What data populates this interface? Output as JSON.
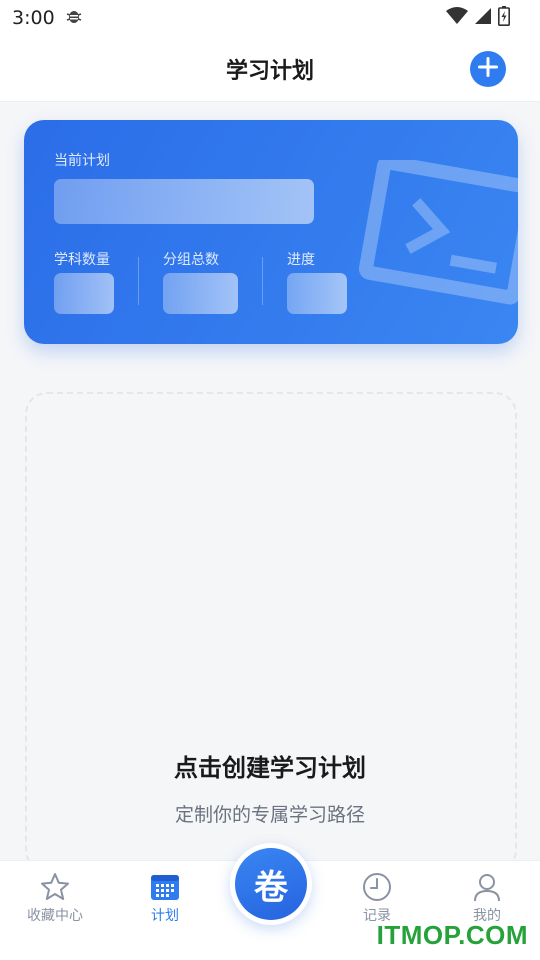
{
  "status_bar": {
    "time": "3:00"
  },
  "header": {
    "title": "学习计划",
    "add_icon": "plus-icon"
  },
  "plan_card": {
    "current_plan_label": "当前计划",
    "subject_count_label": "学科数量",
    "group_total_label": "分组总数",
    "progress_label": "进度",
    "decoration_icon": "terminal-icon"
  },
  "empty_state": {
    "title": "点击创建学习计划",
    "subtitle": "定制你的专属学习路径"
  },
  "tab_bar": {
    "tabs": [
      {
        "label": "收藏中心",
        "icon": "star-icon"
      },
      {
        "label": "计划",
        "icon": "calendar-icon"
      },
      {
        "label": "记录",
        "icon": "clock-icon"
      },
      {
        "label": "我的",
        "icon": "user-icon"
      }
    ],
    "center_button_label": "卷",
    "active_tab": "计划"
  },
  "watermark": "ITMOP.COM",
  "colors": {
    "accent": "#2f7bf0",
    "card_gradient_start": "#2b6de8",
    "card_gradient_end": "#3a86f2",
    "watermark": "#25a33a"
  }
}
